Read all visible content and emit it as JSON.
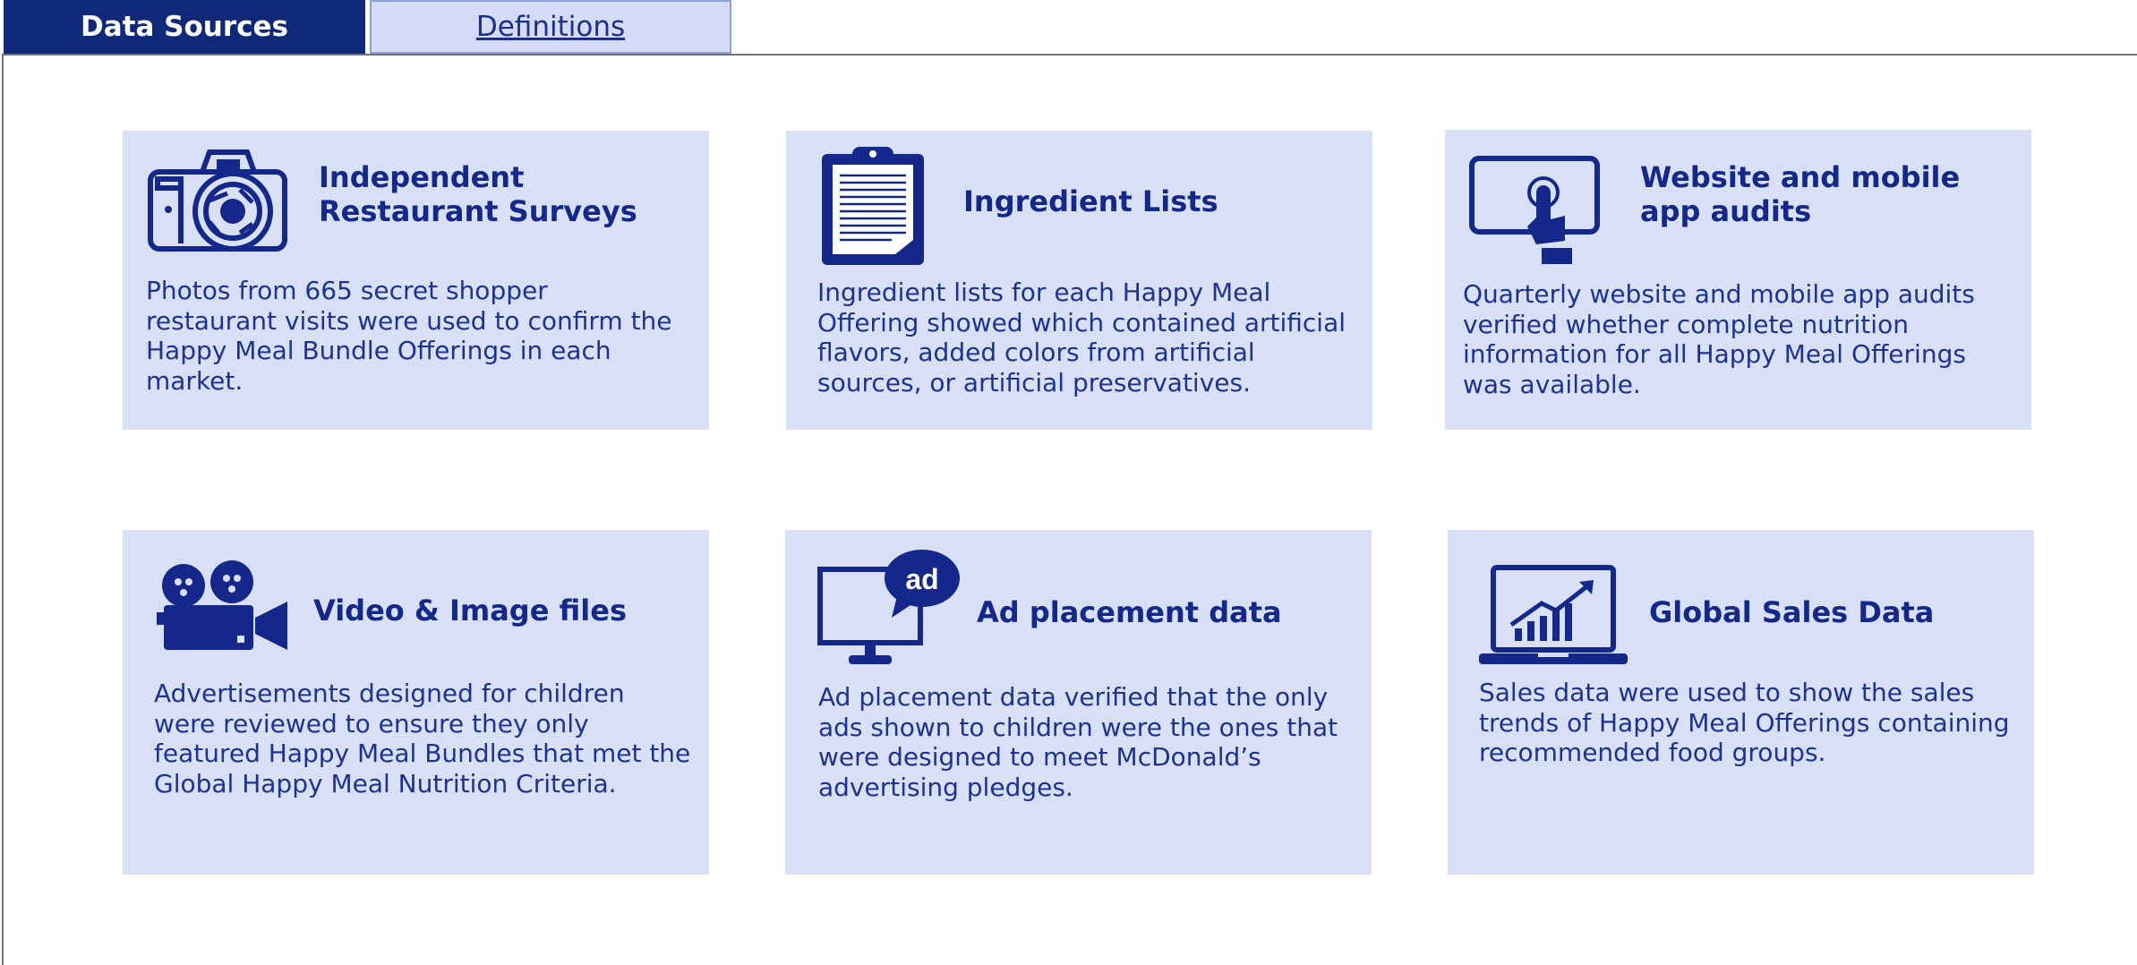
{
  "tabs": [
    {
      "label": "Data Sources",
      "active": true
    },
    {
      "label": "Definitions",
      "active": false
    }
  ],
  "cards": [
    {
      "icon": "camera-icon",
      "title": "Independent Restaurant Surveys",
      "body": "Photos from 665 secret shopper restaurant visits were used to confirm the Happy Meal Bundle Offerings in each market."
    },
    {
      "icon": "clipboard-icon",
      "title": "Ingredient Lists",
      "body": "Ingredient lists for each Happy Meal Offering showed which contained artificial flavors, added colors from artificial sources, or artificial preservatives."
    },
    {
      "icon": "tablet-touch-icon",
      "title": "Website and mobile app audits",
      "body": "Quarterly website and mobile app audits verified whether complete nutrition information for all Happy Meal Offerings was available."
    },
    {
      "icon": "video-camera-icon",
      "title": "Video & Image files",
      "body": "Advertisements designed for children were reviewed to ensure they only featured Happy Meal Bundles that met the Global Happy Meal Nutrition Criteria."
    },
    {
      "icon": "monitor-ad-icon",
      "title": "Ad placement data",
      "body": "Ad placement data verified that the only ads shown to children were the ones that were designed to meet McDonald’s advertising pledges.",
      "icon_badge": "ad"
    },
    {
      "icon": "laptop-chart-icon",
      "title": "Global Sales Data",
      "body": "Sales data were used to show the sales trends of Happy Meal Offerings containing recommended food groups."
    }
  ],
  "colors": {
    "brand_dark": "#0f2878",
    "card_bg": "#d7e0f4",
    "text": "#1b2f8c",
    "tab_inactive_bg": "#d3dbf6"
  }
}
